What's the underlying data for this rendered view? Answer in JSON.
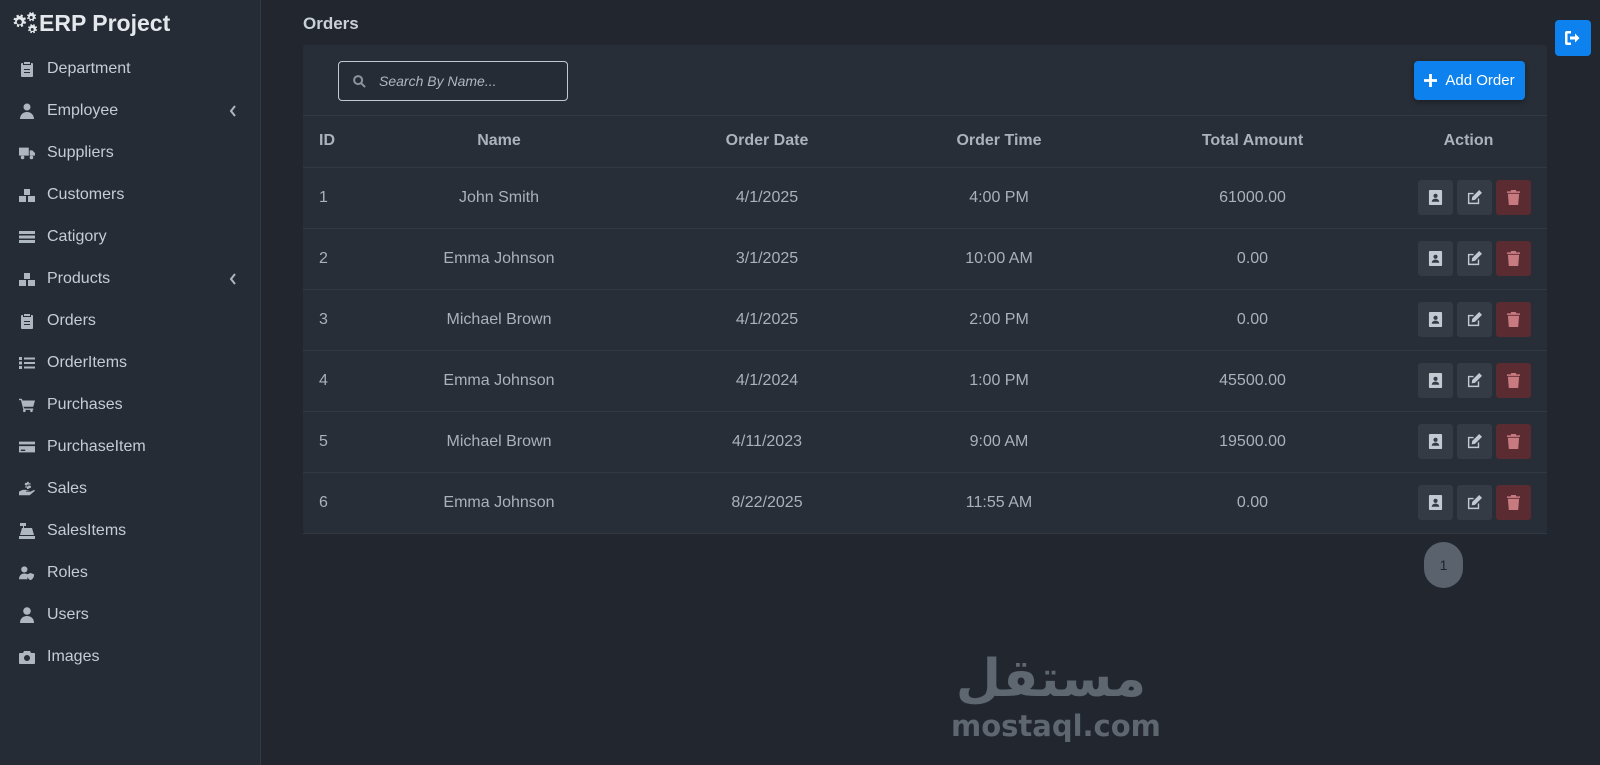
{
  "app": {
    "title": "ERP Project",
    "brand_icon": "gears-icon"
  },
  "sidebar": {
    "items": [
      {
        "label": "Department",
        "icon": "clipboard-icon",
        "has_submenu": false
      },
      {
        "label": "Employee",
        "icon": "user-tie-icon",
        "has_submenu": true
      },
      {
        "label": "Suppliers",
        "icon": "truck-icon",
        "has_submenu": false
      },
      {
        "label": "Customers",
        "icon": "boxes-icon",
        "has_submenu": false
      },
      {
        "label": "Catigory",
        "icon": "table-list-icon",
        "has_submenu": false
      },
      {
        "label": "Products",
        "icon": "boxes-icon",
        "has_submenu": true
      },
      {
        "label": "Orders",
        "icon": "clipboard-icon",
        "has_submenu": false
      },
      {
        "label": "OrderItems",
        "icon": "list-icon",
        "has_submenu": false
      },
      {
        "label": "Purchases",
        "icon": "cart-icon",
        "has_submenu": false
      },
      {
        "label": "PurchaseItem",
        "icon": "credit-card-icon",
        "has_submenu": false
      },
      {
        "label": "Sales",
        "icon": "hand-dollar-icon",
        "has_submenu": false
      },
      {
        "label": "SalesItems",
        "icon": "cash-register-icon",
        "has_submenu": false
      },
      {
        "label": "Roles",
        "icon": "user-shield-icon",
        "has_submenu": false
      },
      {
        "label": "Users",
        "icon": "user-icon",
        "has_submenu": false
      },
      {
        "label": "Images",
        "icon": "camera-icon",
        "has_submenu": false
      }
    ]
  },
  "main": {
    "title": "Orders",
    "search": {
      "placeholder": "Search By Name...",
      "value": ""
    },
    "add_button": {
      "label": "Add Order"
    },
    "table": {
      "headers": [
        "ID",
        "Name",
        "Order Date",
        "Order Time",
        "Total Amount",
        "Action"
      ],
      "rows": [
        {
          "id": "1",
          "name": "John Smith",
          "date": "4/1/2025",
          "time": "4:00 PM",
          "amount": "61000.00"
        },
        {
          "id": "2",
          "name": "Emma Johnson",
          "date": "3/1/2025",
          "time": "10:00 AM",
          "amount": "0.00"
        },
        {
          "id": "3",
          "name": "Michael Brown",
          "date": "4/1/2025",
          "time": "2:00 PM",
          "amount": "0.00"
        },
        {
          "id": "4",
          "name": "Emma Johnson",
          "date": "4/1/2024",
          "time": "1:00 PM",
          "amount": "45500.00"
        },
        {
          "id": "5",
          "name": "Michael Brown",
          "date": "4/11/2023",
          "time": "9:00 AM",
          "amount": "19500.00"
        },
        {
          "id": "6",
          "name": "Emma Johnson",
          "date": "8/22/2025",
          "time": "11:55 AM",
          "amount": "0.00"
        }
      ],
      "row_actions": [
        "view",
        "edit",
        "delete"
      ]
    },
    "pagination": {
      "current_page": "1"
    }
  },
  "watermark": {
    "arabic": "مستقل",
    "latin": "mostaql.com"
  },
  "colors": {
    "primary": "#0d82ee",
    "danger": "#5a2b31",
    "sidebar_bg": "#262c35",
    "page_bg": "#22272f"
  }
}
